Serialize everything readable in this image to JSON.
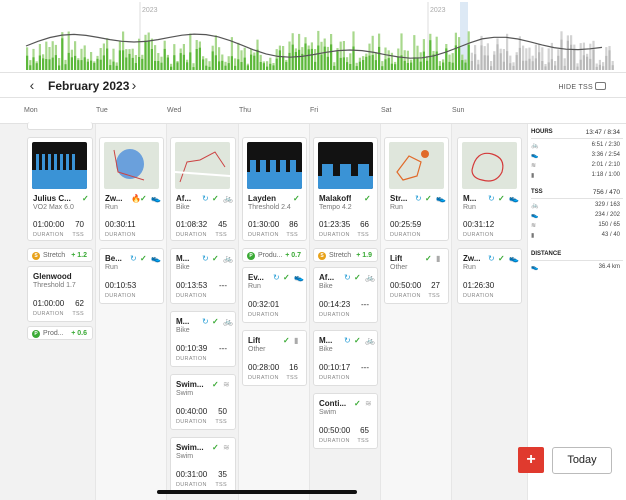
{
  "chart": {
    "year_labels": [
      "2023",
      "2023"
    ],
    "bar_color_green": "#5cb83a",
    "bar_color_lightgreen": "#a8d88d",
    "bar_color_grey": "#b9b9b9"
  },
  "header": {
    "month": "February 2023",
    "prev_icon": "chevron-left-icon",
    "next_icon": "chevron-right-icon",
    "hide_tss": "HIDE TSS"
  },
  "weekdays": [
    "Mon",
    "Tue",
    "Wed",
    "Thu",
    "Fri",
    "Sat",
    "Sun"
  ],
  "labels": {
    "duration": "DURATION",
    "tss": "TSS"
  },
  "days": {
    "mon": {
      "workouts": [
        {
          "title": "Julius C...",
          "sub": "VO2 Max 6.0",
          "duration": "01:00:00",
          "tss": "70"
        },
        {
          "title": "Glenwood",
          "sub": "Threshold 1.7",
          "duration": "01:00:00",
          "tss": "62"
        }
      ],
      "notes": [
        {
          "label": "Stretch",
          "value": "+ 1.2"
        },
        {
          "label": "Prod...",
          "value": "+ 0.6"
        }
      ]
    },
    "tue": {
      "workouts": [
        {
          "title": "Zw...",
          "sub": "Run",
          "duration": "00:30:11",
          "tss": ""
        },
        {
          "title": "Be...",
          "sub": "Run",
          "duration": "00:10:53",
          "tss": ""
        }
      ]
    },
    "wed": {
      "workouts": [
        {
          "title": "Af...",
          "sub": "Bike",
          "duration": "01:08:32",
          "tss": "45"
        },
        {
          "title": "M...",
          "sub": "Bike",
          "duration": "00:13:53",
          "tss": "---"
        },
        {
          "title": "M...",
          "sub": "Bike",
          "duration": "00:10:39",
          "tss": "---"
        },
        {
          "title": "Swim...",
          "sub": "Swim",
          "duration": "00:40:00",
          "tss": "50"
        },
        {
          "title": "Swim...",
          "sub": "Swim",
          "duration": "00:31:00",
          "tss": "35"
        }
      ]
    },
    "thu": {
      "workouts": [
        {
          "title": "Layden",
          "sub": "Threshold 2.4",
          "duration": "01:30:00",
          "tss": "86"
        },
        {
          "title": "Ev...",
          "sub": "Run",
          "duration": "00:32:01",
          "tss": ""
        },
        {
          "title": "Lift",
          "sub": "Other",
          "duration": "00:28:00",
          "tss": "16"
        }
      ],
      "notes": [
        {
          "label": "Produ...",
          "value": "+ 0.7"
        }
      ]
    },
    "fri": {
      "workouts": [
        {
          "title": "Malakoff",
          "sub": "Tempo 4.2",
          "duration": "01:23:35",
          "tss": "66"
        },
        {
          "title": "Af...",
          "sub": "Bike",
          "duration": "00:14:23",
          "tss": "---"
        },
        {
          "title": "M...",
          "sub": "Bike",
          "duration": "00:10:17",
          "tss": "---"
        },
        {
          "title": "Conti...",
          "sub": "Swim",
          "duration": "00:50:00",
          "tss": "65"
        }
      ],
      "notes": [
        {
          "label": "Stretch",
          "value": "+ 1.9"
        }
      ]
    },
    "sat": {
      "workouts": [
        {
          "title": "Str...",
          "sub": "Run",
          "duration": "00:25:59",
          "tss": ""
        },
        {
          "title": "Lift",
          "sub": "Other",
          "duration": "00:50:00",
          "tss": "27"
        }
      ]
    },
    "sun": {
      "workouts": [
        {
          "title": "M...",
          "sub": "Run",
          "duration": "00:31:12",
          "tss": ""
        },
        {
          "title": "Zw...",
          "sub": "Run",
          "duration": "01:26:30",
          "tss": ""
        }
      ]
    }
  },
  "summary": {
    "hours_label": "HOURS",
    "hours_total": "13:47 / 8:34",
    "hours_rows": [
      "6:51 / 2:30",
      "3:36 / 2:54",
      "2:01 / 2:10",
      "1:18 / 1:00"
    ],
    "tss_label": "TSS",
    "tss_total": "756 / 470",
    "tss_rows": [
      "329 / 163",
      "234 / 202",
      "150 / 65",
      "43 / 40"
    ],
    "distance_label": "DISTANCE",
    "distance_rows": [
      "36.4 km"
    ]
  },
  "buttons": {
    "add": "+",
    "today": "Today"
  }
}
